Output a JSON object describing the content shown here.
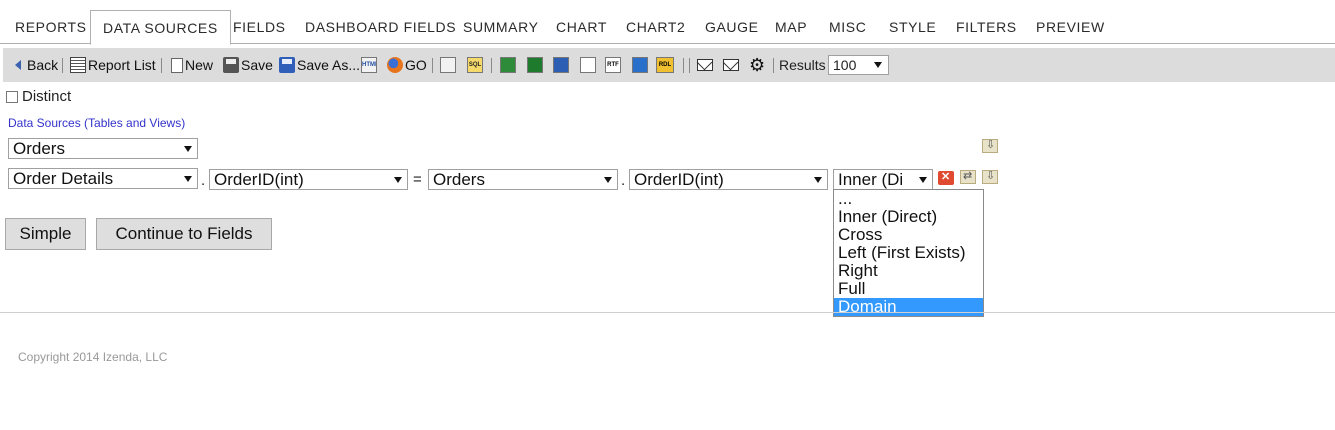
{
  "tabs": [
    {
      "label": "REPORTS"
    },
    {
      "label": "DATA SOURCES"
    },
    {
      "label": "FIELDS"
    },
    {
      "label": "DASHBOARD FIELDS"
    },
    {
      "label": "SUMMARY"
    },
    {
      "label": "CHART"
    },
    {
      "label": "CHART2"
    },
    {
      "label": "GAUGE"
    },
    {
      "label": "MAP"
    },
    {
      "label": "MISC"
    },
    {
      "label": "STYLE"
    },
    {
      "label": "FILTERS"
    },
    {
      "label": "PREVIEW"
    }
  ],
  "toolbar": {
    "back": "Back",
    "report_list": "Report List",
    "new": "New",
    "save": "Save",
    "save_as": "Save As...",
    "go": "GO",
    "html_icon": "HTML",
    "sql_icon": "SQL",
    "rtf_icon": "RTF",
    "rdl_icon": "RDL",
    "results_label": "Results",
    "results_value": "100"
  },
  "distinct_label": "Distinct",
  "data_sources_link": "Data Sources (Tables and Views)",
  "primary_table": "Orders",
  "join": {
    "left_table": "Order Details",
    "left_field": "OrderID(int)",
    "equals": "=",
    "dot": ".",
    "right_table": "Orders",
    "right_field": "OrderID(int)",
    "join_type": "Inner (Di"
  },
  "join_options": [
    "...",
    "Inner (Direct)",
    "Cross",
    "Left (First Exists)",
    "Right",
    "Full",
    "Domain"
  ],
  "buttons": {
    "simple": "Simple",
    "continue": "Continue to Fields"
  },
  "copyright": "Copyright 2014 Izenda, LLC",
  "colors": {
    "toolbar_bg": "#dcdcdc",
    "link": "#3333cc",
    "selected_option": "#3399ff"
  }
}
